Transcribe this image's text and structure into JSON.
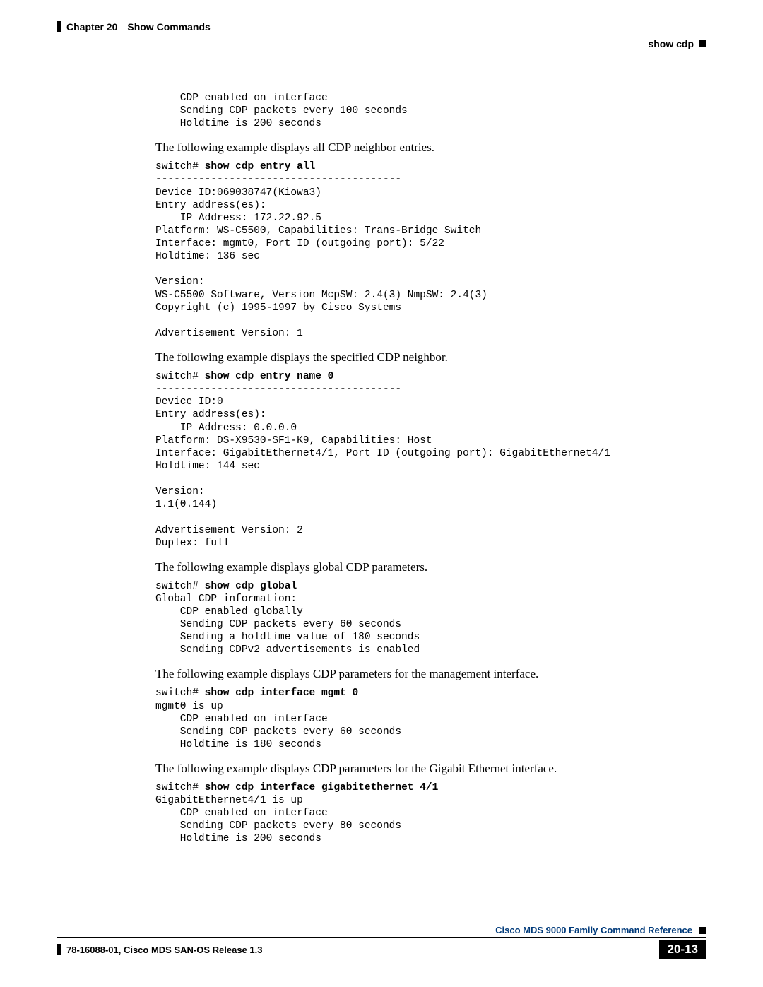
{
  "header": {
    "chapter": "Chapter 20",
    "section": "Show Commands",
    "subhead": "show cdp"
  },
  "blocks": {
    "intro_code": "    CDP enabled on interface\n    Sending CDP packets every 100 seconds\n    Holdtime is 200 seconds",
    "p1": "The following example displays all CDP neighbor entries.",
    "c1_prompt": "switch# ",
    "c1_cmd": "show cdp entry all",
    "c1_body": "----------------------------------------\nDevice ID:069038747(Kiowa3)\nEntry address(es):\n    IP Address: 172.22.92.5\nPlatform: WS-C5500, Capabilities: Trans-Bridge Switch\nInterface: mgmt0, Port ID (outgoing port): 5/22\nHoldtime: 136 sec\n\nVersion:\nWS-C5500 Software, Version McpSW: 2.4(3) NmpSW: 2.4(3)\nCopyright (c) 1995-1997 by Cisco Systems\n\nAdvertisement Version: 1",
    "p2": "The following example displays the specified CDP neighbor.",
    "c2_prompt": "switch# ",
    "c2_cmd": "show cdp entry name 0",
    "c2_body": "----------------------------------------\nDevice ID:0\nEntry address(es):\n    IP Address: 0.0.0.0\nPlatform: DS-X9530-SF1-K9, Capabilities: Host\nInterface: GigabitEthernet4/1, Port ID (outgoing port): GigabitEthernet4/1\nHoldtime: 144 sec\n\nVersion:\n1.1(0.144)\n\nAdvertisement Version: 2\nDuplex: full",
    "p3": "The following example displays global CDP parameters.",
    "c3_prompt": "switch# ",
    "c3_cmd": "show cdp global",
    "c3_body": "Global CDP information:\n    CDP enabled globally\n    Sending CDP packets every 60 seconds\n    Sending a holdtime value of 180 seconds\n    Sending CDPv2 advertisements is enabled",
    "p4": "The following example displays CDP parameters for the management interface.",
    "c4_prompt": "switch# ",
    "c4_cmd": "show cdp interface mgmt 0",
    "c4_body": "mgmt0 is up\n    CDP enabled on interface\n    Sending CDP packets every 60 seconds\n    Holdtime is 180 seconds",
    "p5": "The following example displays CDP parameters for the Gigabit Ethernet interface.",
    "c5_prompt": "switch# ",
    "c5_cmd": "show cdp interface gigabitethernet 4/1",
    "c5_body": "GigabitEthernet4/1 is up\n    CDP enabled on interface\n    Sending CDP packets every 80 seconds\n    Holdtime is 200 seconds"
  },
  "footer": {
    "title": "Cisco MDS 9000 Family Command Reference",
    "left": "78-16088-01, Cisco MDS SAN-OS Release 1.3",
    "page": "20-13"
  }
}
